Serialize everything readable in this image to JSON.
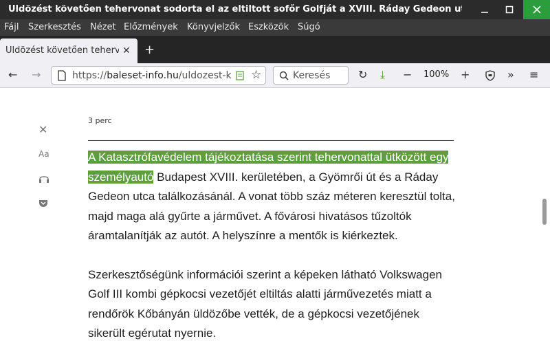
{
  "window": {
    "title": "Üldözést követően tehervonat sodorta el az eltiltott sofőr Golfját a XVIII. Ráday Gedeon utcában..."
  },
  "menu": [
    "Fájl",
    "Szerkesztés",
    "Nézet",
    "Előzmények",
    "Könyvjelzők",
    "Eszközök",
    "Súgó"
  ],
  "tab": {
    "label": "Üldözést követően tehervo"
  },
  "urlbar": {
    "prefix": "https://",
    "host": "baleset-info.hu",
    "path": "/uldozest-k"
  },
  "search": {
    "placeholder": "Keresés"
  },
  "zoom": "100%",
  "reader": {
    "reading_time": "3 perc",
    "font_label": "Aa",
    "paragraphs": [
      {
        "highlighted": "A Katasztrófavédelem tájékoztatása szerint tehervonattal ütközött egy személyautó",
        "rest": " Budapest XVIII. kerületében, a Gyömrői út és a Ráday Gedeon utca találkozásánál. A vonat több száz méteren keresztül tolta, majd maga alá gyűrte a járművet. A fővárosi hivatásos tűzoltók áramtalanítják az autót. A helyszínre a mentők is kiérkeztek."
      },
      {
        "text": "Szerkesztőségünk információi szerint a képeken látható Volkswagen Golf III kombi gépkocsi vezetőjét eltiltás alatti járművezetés miatt a rendőrök Kőbányán üldözőbe vették, de a gépkocsi vezetőjének sikerült egérutat nyernie."
      }
    ]
  },
  "colors": {
    "highlight": "#5f9e3f",
    "titlebar": "#2b2b2b",
    "close": "#2a9d3c"
  }
}
